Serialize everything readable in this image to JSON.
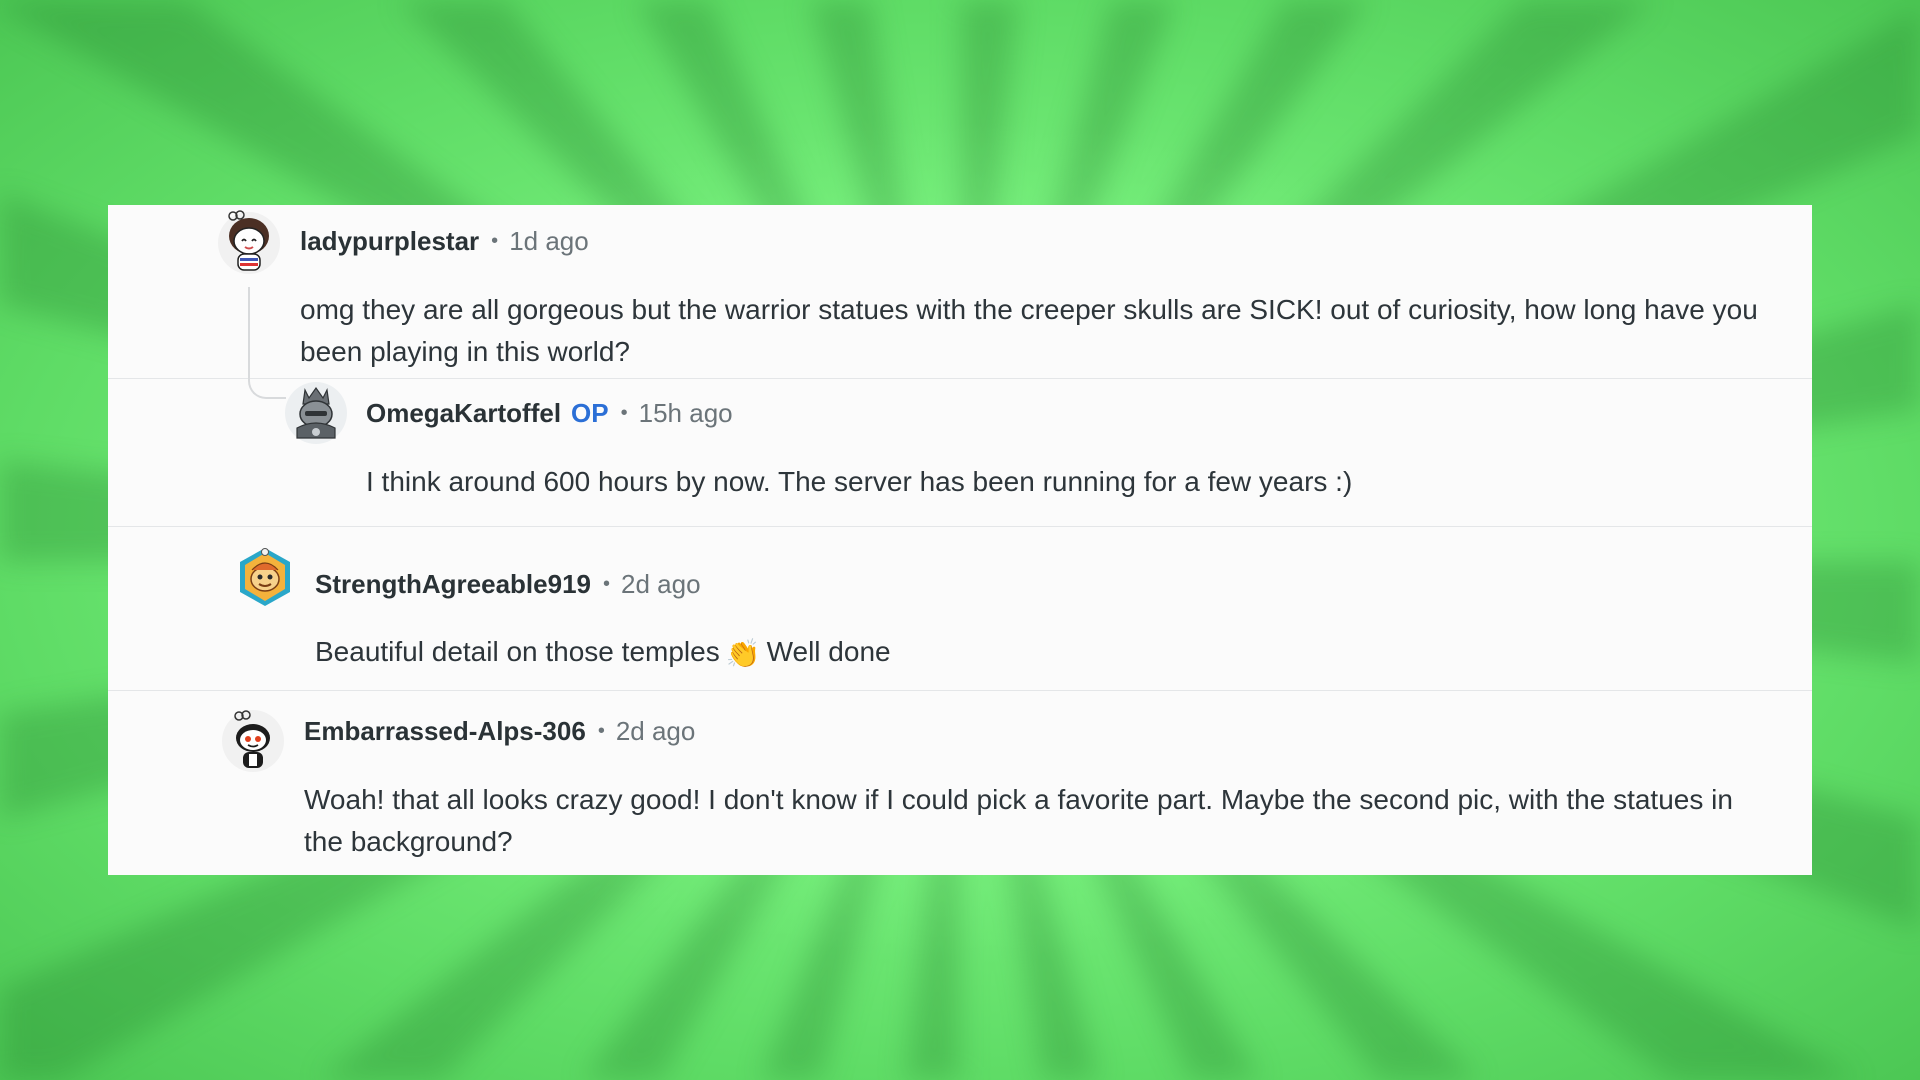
{
  "comments": [
    {
      "username": "ladypurplestar",
      "time": "1d ago",
      "text": "omg they are all gorgeous but the warrior statues with the creeper skulls are SICK! out of curiosity, how long have you been playing in this world?",
      "avatar_icon": "snoo-avatar-girl-icon"
    },
    {
      "username": "OmegaKartoffel",
      "badge": "OP",
      "time": "15h ago",
      "text": "I think around 600 hours by now. The server has been running for a few years :)",
      "avatar_icon": "snoo-avatar-armored-icon"
    },
    {
      "username": "StrengthAgreeable919",
      "time": "2d ago",
      "text_before": "Beautiful detail on those temples",
      "emoji": "👏",
      "text_after": "Well done",
      "avatar_icon": "snoo-avatar-hexagon-icon"
    },
    {
      "username": "Embarrassed-Alps-306",
      "time": "2d ago",
      "text": "Woah! that all looks crazy good! I don't know if I could pick a favorite part. Maybe the second pic, with the statues in the background?",
      "avatar_icon": "snoo-avatar-default-icon"
    }
  ],
  "separator": "•",
  "colors": {
    "background": "#78f07d",
    "panel": "#fbfbfb",
    "username": "#2a3236",
    "op_badge": "#2b6fd6",
    "meta": "#6b7479"
  }
}
